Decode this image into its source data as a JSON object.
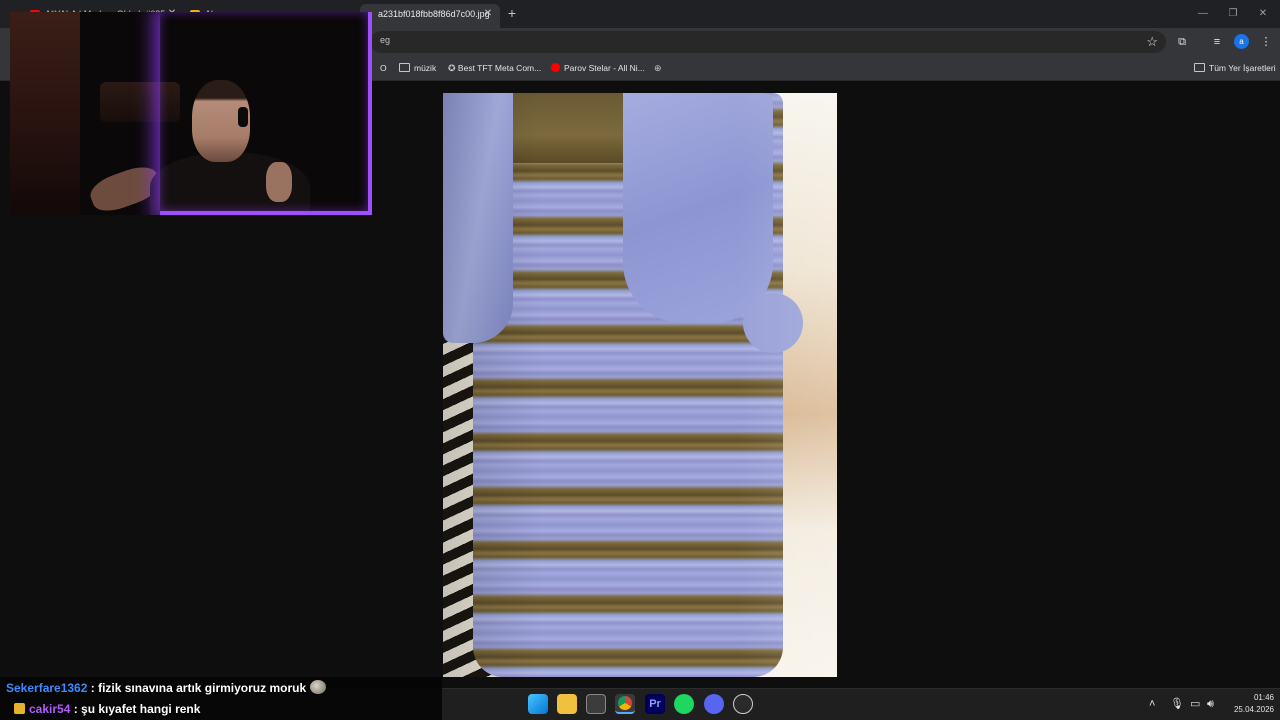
{
  "browser": {
    "tabs": [
      {
        "title": "A*YALA | Madara Oldu k #685",
        "active": false
      },
      {
        "title": "Ab...",
        "active": false
      },
      {
        "title": "a231bf018fbb8f86d7c00.jpg",
        "active": true
      }
    ],
    "tab_list_icon": "chevron-down-icon",
    "address_text": "eg",
    "bookmarks": [
      {
        "label": "O",
        "icon": "text-icon"
      },
      {
        "label": "müzik",
        "icon": "folder-icon"
      },
      {
        "label": "Best TFT Meta Com...",
        "icon": "tft-icon"
      },
      {
        "label": "Parov Stelar - All Ni...",
        "icon": "youtube-icon"
      },
      {
        "label": "",
        "icon": "globe-icon"
      }
    ],
    "all_bookmarks_label": "Tüm Yer İşaretleri",
    "profile_initial": "a"
  },
  "chat": [
    {
      "user": "Sekerfare1362",
      "user_color": "#3d8bff",
      "message": " : fizik sınavına artık girmiyoruz moruk",
      "has_emote": true
    },
    {
      "user": "cakir54",
      "user_color": "#b25cff",
      "message": " : şu kıyafet hangi renk",
      "has_badge": true
    }
  ],
  "taskbar": {
    "apps": [
      "windows-start-icon",
      "file-explorer-icon",
      "microsoft-store-icon",
      "chrome-icon",
      "premiere-pro-icon",
      "spotify-icon",
      "discord-icon",
      "steam-icon"
    ],
    "premiere_label": "Pr",
    "time": "01:46",
    "date": "25.04.2026"
  },
  "colors": {
    "accent_glow": "#a24dff",
    "chat_user1": "#3d8bff",
    "chat_user2": "#b25cff"
  }
}
